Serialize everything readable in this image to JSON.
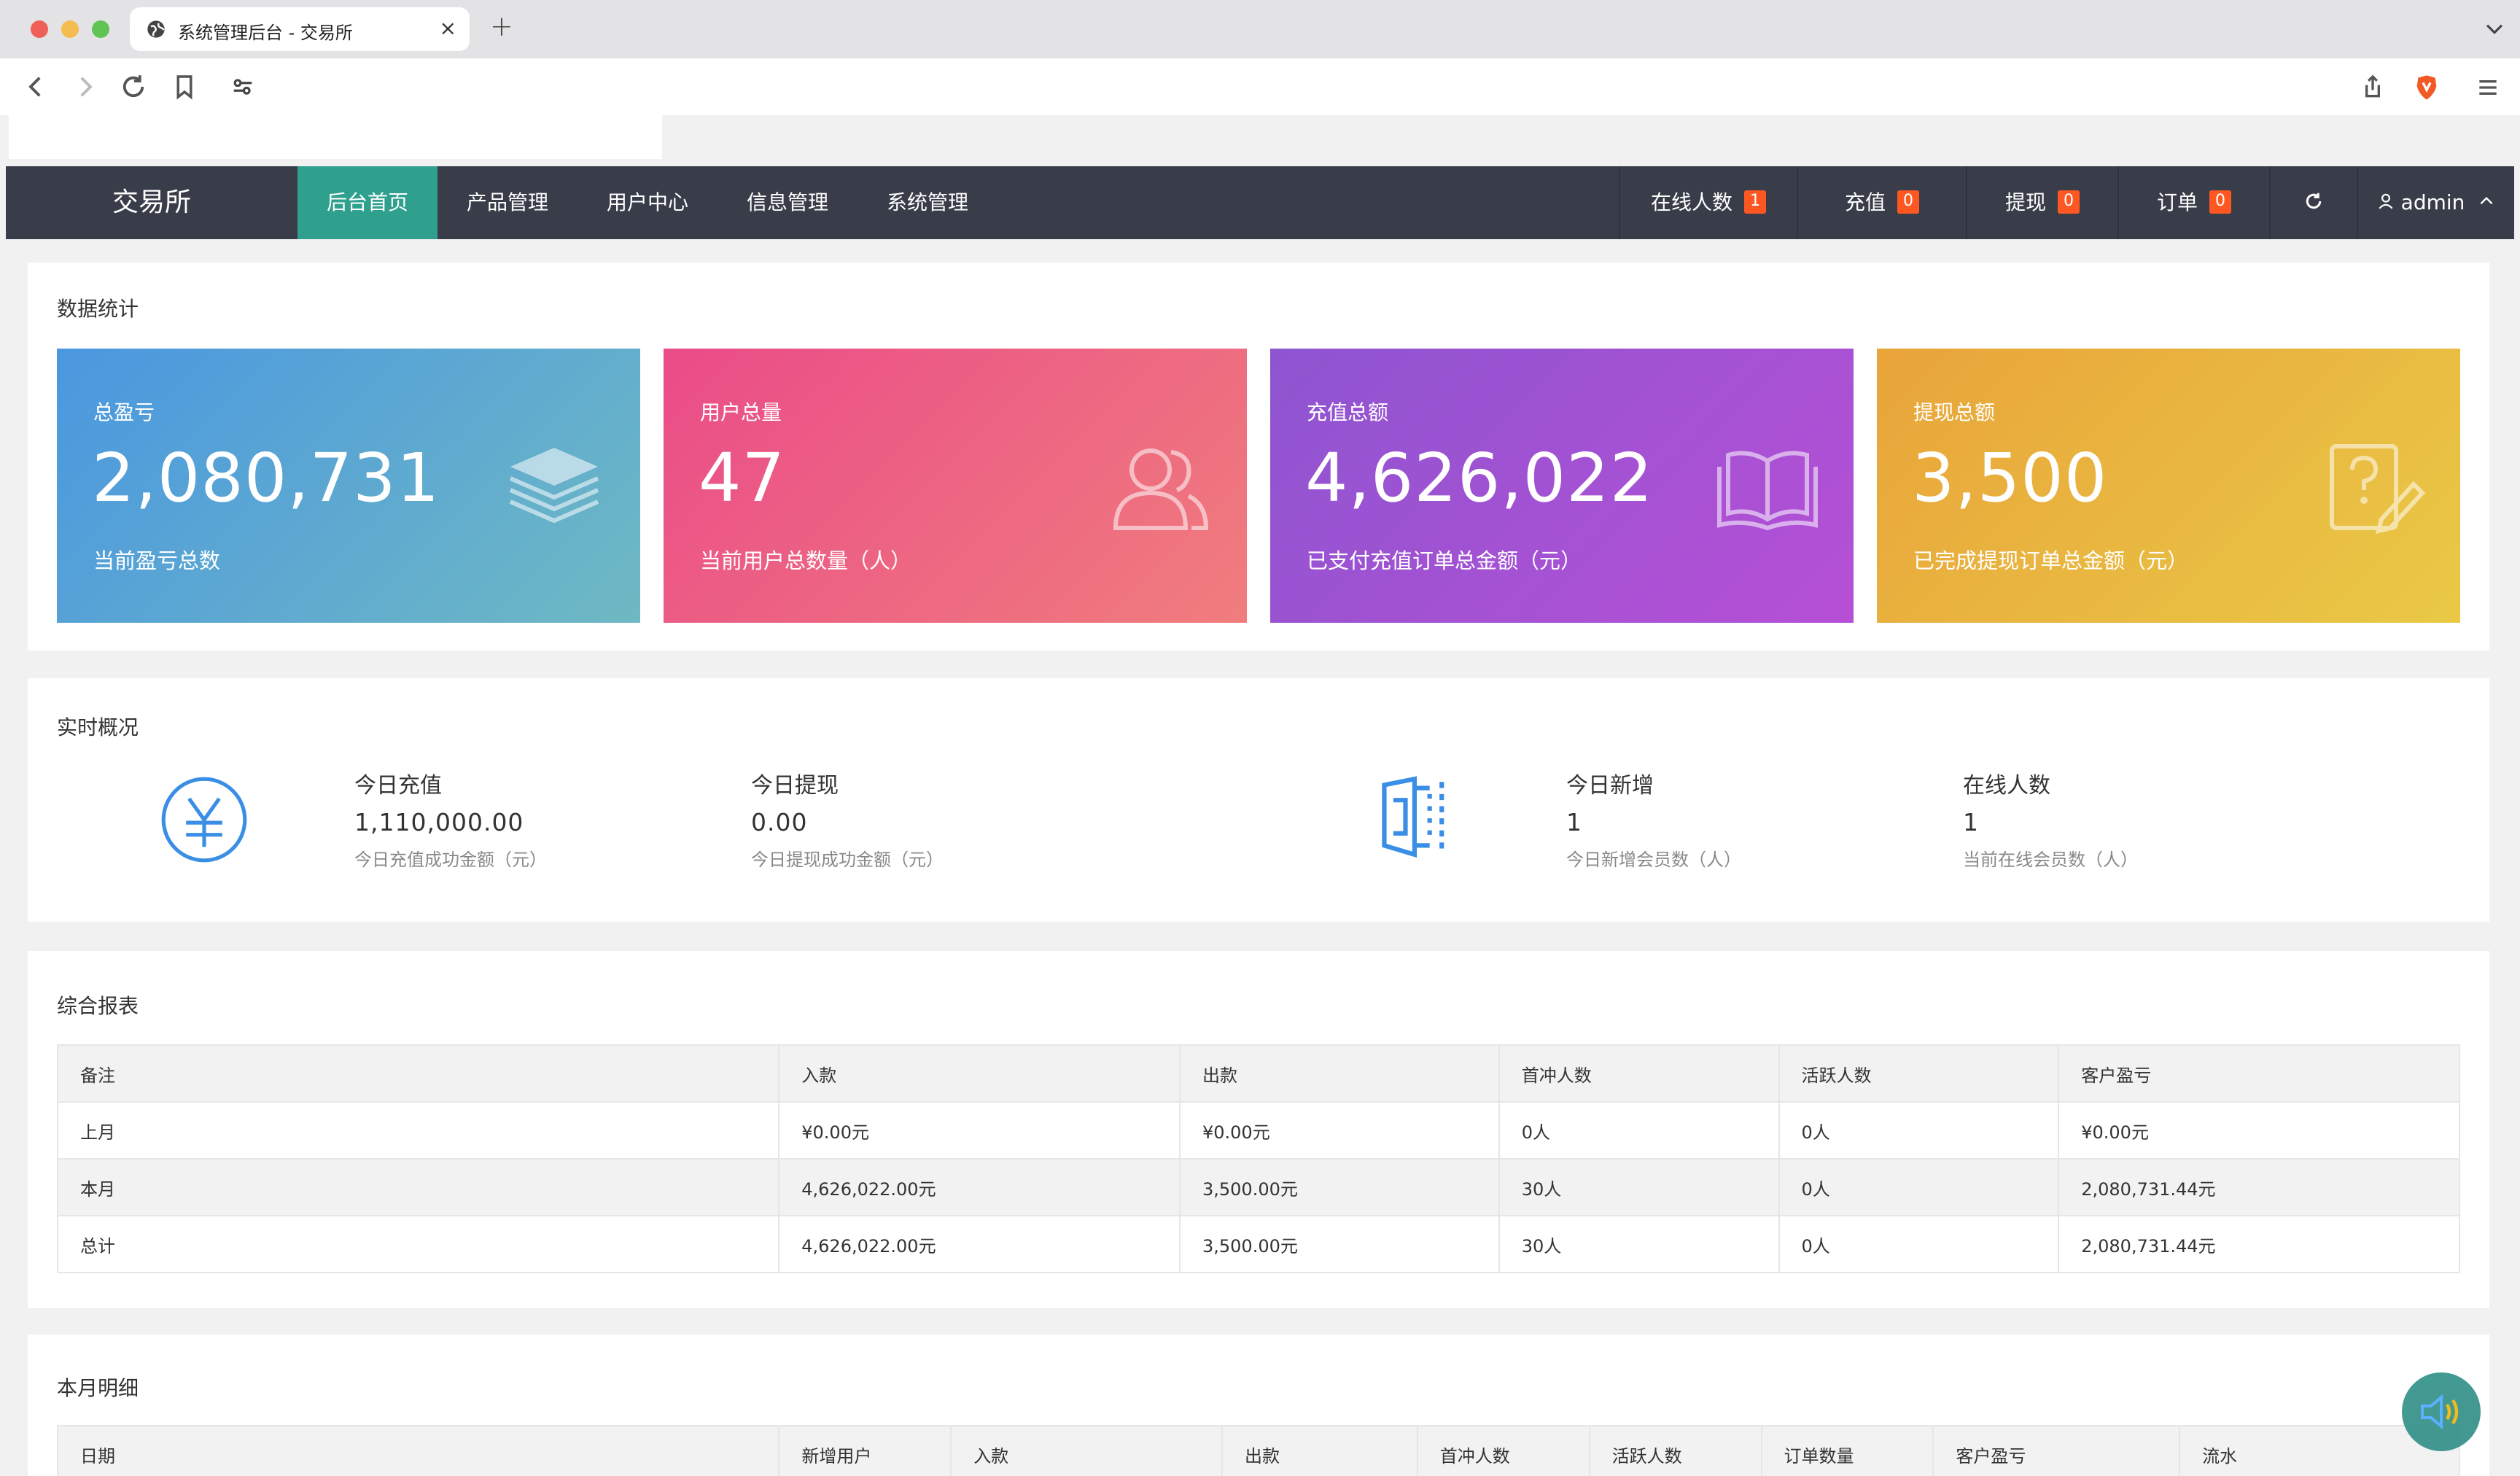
{
  "browser": {
    "tab_title": "系统管理后台 - 交易所",
    "new_tab_label": "+",
    "close_label": "×"
  },
  "nav": {
    "logo": "交易所",
    "items": [
      {
        "label": "后台首页",
        "active": true
      },
      {
        "label": "产品管理"
      },
      {
        "label": "用户中心"
      },
      {
        "label": "信息管理"
      },
      {
        "label": "系统管理"
      }
    ],
    "right": {
      "online": {
        "label": "在线人数",
        "count": "1"
      },
      "recharge": {
        "label": "充值",
        "count": "0"
      },
      "withdraw": {
        "label": "提现",
        "count": "0"
      },
      "orders": {
        "label": "订单",
        "count": "0"
      },
      "user": "admin"
    }
  },
  "stats": {
    "title": "数据统计",
    "cards": [
      {
        "label": "总盈亏",
        "value": "2,080,731",
        "desc": "当前盈亏总数",
        "icon": "layers-icon"
      },
      {
        "label": "用户总量",
        "value": "47",
        "desc": "当前用户总数量（人）",
        "icon": "users-icon"
      },
      {
        "label": "充值总额",
        "value": "4,626,022",
        "desc": "已支付充值订单总金额（元）",
        "icon": "book-icon"
      },
      {
        "label": "提现总额",
        "value": "3,500",
        "desc": "已完成提现订单总金额（元）",
        "icon": "question-edit-icon"
      }
    ]
  },
  "realtime": {
    "title": "实时概况",
    "today_recharge": {
      "label": "今日充值",
      "value": "1,110,000.00",
      "desc": "今日充值成功金额（元）"
    },
    "today_withdraw": {
      "label": "今日提现",
      "value": "0.00",
      "desc": "今日提现成功金额（元）"
    },
    "today_new": {
      "label": "今日新增",
      "value": "1",
      "desc": "今日新增会员数（人）"
    },
    "online": {
      "label": "在线人数",
      "value": "1",
      "desc": "当前在线会员数（人）"
    }
  },
  "report": {
    "title": "综合报表",
    "headers": [
      "备注",
      "入款",
      "出款",
      "首冲人数",
      "活跃人数",
      "客户盈亏"
    ],
    "rows": [
      [
        "上月",
        "¥0.00元",
        "¥0.00元",
        "0人",
        "0人",
        "¥0.00元"
      ],
      [
        "本月",
        "4,626,022.00元",
        "3,500.00元",
        "30人",
        "0人",
        "2,080,731.44元"
      ],
      [
        "总计",
        "4,626,022.00元",
        "3,500.00元",
        "30人",
        "0人",
        "2,080,731.44元"
      ]
    ]
  },
  "monthly": {
    "title": "本月明细",
    "headers": [
      "日期",
      "新增用户",
      "入款",
      "出款",
      "首冲人数",
      "活跃人数",
      "订单数量",
      "客户盈亏",
      "流水"
    ]
  }
}
